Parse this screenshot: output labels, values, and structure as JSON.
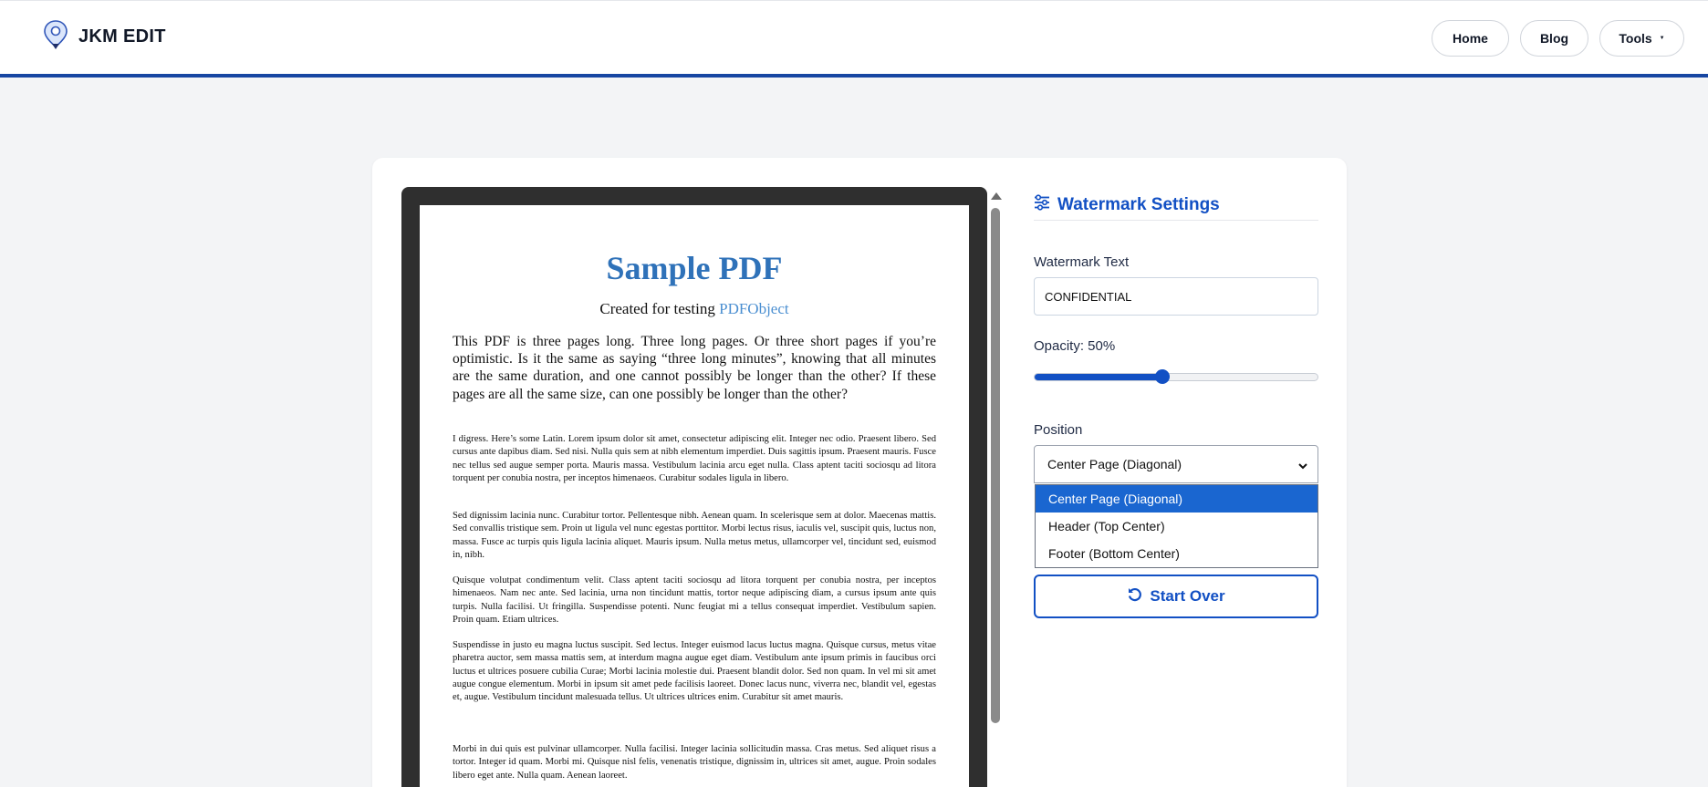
{
  "header": {
    "brand": "JKM EDIT",
    "nav": {
      "home": "Home",
      "blog": "Blog",
      "tools": "Tools"
    }
  },
  "pdf": {
    "title": "Sample PDF",
    "subtitle_prefix": "Created for testing",
    "subtitle_link": "PDFObject",
    "lead": "This PDF is three pages long. Three long pages. Or three short pages if you’re optimistic. Is it the same as saying “three long minutes”, knowing that all minutes are the same duration, and one cannot possibly be longer than the other? If these pages are all the same size, can one possibly be longer than the other?",
    "paragraphs": [
      "I digress. Here’s some Latin. Lorem ipsum dolor sit amet, consectetur adipiscing elit. Integer nec odio. Praesent libero. Sed cursus ante dapibus diam. Sed nisi. Nulla quis sem at nibh elementum imperdiet. Duis sagittis ipsum. Praesent mauris. Fusce nec tellus sed augue semper porta. Mauris massa. Vestibulum lacinia arcu eget nulla. Class aptent taciti sociosqu ad litora torquent per conubia nostra, per inceptos himenaeos. Curabitur sodales ligula in libero.",
      "Sed dignissim lacinia nunc. Curabitur tortor. Pellentesque nibh. Aenean quam. In scelerisque sem at dolor. Maecenas mattis. Sed convallis tristique sem. Proin ut ligula vel nunc egestas porttitor. Morbi lectus risus, iaculis vel, suscipit quis, luctus non, massa. Fusce ac turpis quis ligula lacinia aliquet. Mauris ipsum. Nulla metus metus, ullamcorper vel, tincidunt sed, euismod in, nibh.",
      "Quisque volutpat condimentum velit. Class aptent taciti sociosqu ad litora torquent per conubia nostra, per inceptos himenaeos. Nam nec ante. Sed lacinia, urna non tincidunt mattis, tortor neque adipiscing diam, a cursus ipsum ante quis turpis. Nulla facilisi. Ut fringilla. Suspendisse potenti. Nunc feugiat mi a tellus consequat imperdiet. Vestibulum sapien. Proin quam. Etiam ultrices.",
      "Suspendisse in justo eu magna luctus suscipit. Sed lectus. Integer euismod lacus luctus magna. Quisque cursus, metus vitae pharetra auctor, sem massa mattis sem, at interdum magna augue eget diam. Vestibulum ante ipsum primis in faucibus orci luctus et ultrices posuere cubilia Curae; Morbi lacinia molestie dui. Praesent blandit dolor. Sed non quam. In vel mi sit amet augue congue elementum. Morbi in ipsum sit amet pede facilisis laoreet. Donec lacus nunc, viverra nec, blandit vel, egestas et, augue. Vestibulum tincidunt malesuada tellus. Ut ultrices ultrices enim. Curabitur sit amet mauris.",
      "Morbi in dui quis est pulvinar ullamcorper. Nulla facilisi. Integer lacinia sollicitudin massa. Cras metus. Sed aliquet risus a tortor. Integer id quam. Morbi mi. Quisque nisl felis, venenatis tristique, dignissim in, ultrices sit amet, augue. Proin sodales libero eget ante. Nulla quam. Aenean laoreet."
    ]
  },
  "settings": {
    "title": "Watermark Settings",
    "text_label": "Watermark Text",
    "text_value": "CONFIDENTIAL",
    "opacity_label": "Opacity: 50%",
    "opacity_fraction": 0.45,
    "position_label": "Position",
    "position_selected": "Center Page (Diagonal)",
    "position_options": [
      "Center Page (Diagonal)",
      "Header (Top Center)",
      "Footer (Bottom Center)"
    ],
    "start_over": "Start Over"
  },
  "colors": {
    "accent": "#1250c4",
    "header_border": "#1746a2",
    "selected_option": "#1a66d0"
  }
}
